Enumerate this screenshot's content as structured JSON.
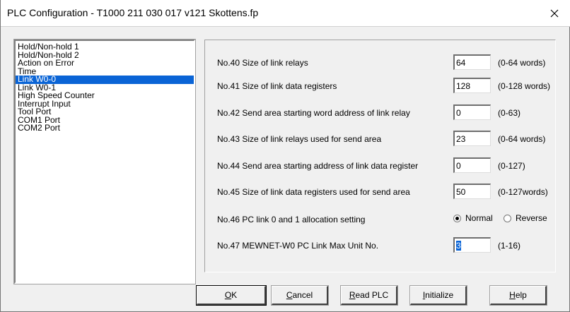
{
  "window": {
    "title": "PLC Configuration - T1000 211 030 017 v121 Skottens.fp",
    "close_glyph": "✕"
  },
  "sidebar": {
    "items": [
      {
        "label": "Hold/Non-hold 1",
        "selected": false
      },
      {
        "label": "Hold/Non-hold 2",
        "selected": false
      },
      {
        "label": "Action on Error",
        "selected": false
      },
      {
        "label": "Time",
        "selected": false
      },
      {
        "label": "Link W0-0",
        "selected": true
      },
      {
        "label": "Link W0-1",
        "selected": false
      },
      {
        "label": "High Speed Counter",
        "selected": false
      },
      {
        "label": "Interrupt Input",
        "selected": false
      },
      {
        "label": "Tool Port",
        "selected": false
      },
      {
        "label": "COM1 Port",
        "selected": false
      },
      {
        "label": "COM2 Port",
        "selected": false
      }
    ]
  },
  "settings": {
    "rows": [
      {
        "label": "No.40 Size of link relays",
        "value": "64",
        "range": "(0-64 words)"
      },
      {
        "label": "No.41 Size of link data registers",
        "value": "128",
        "range": "(0-128 words)"
      },
      {
        "label": "No.42 Send area starting word address of link relay",
        "value": "0",
        "range": "(0-63)"
      },
      {
        "label": "No.43 Size of link relays used for send area",
        "value": "23",
        "range": "(0-64 words)"
      },
      {
        "label": "No.44 Send area starting address of link data register",
        "value": "0",
        "range": "(0-127)"
      },
      {
        "label": "No.45 Size of link data registers used for send area",
        "value": "50",
        "range": "(0-127words)"
      }
    ],
    "allocation": {
      "label": "No.46 PC link 0 and 1 allocation setting",
      "option_normal": "Normal",
      "option_reverse": "Reverse",
      "selected": "Normal"
    },
    "max_unit": {
      "label": "No.47 MEWNET-W0 PC Link Max Unit No.",
      "value": "3",
      "range": "(1-16)"
    }
  },
  "buttons": {
    "ok": {
      "mnemonic": "O",
      "rest": "K"
    },
    "cancel": {
      "mnemonic": "C",
      "rest": "ancel"
    },
    "read_plc": {
      "mnemonic": "R",
      "rest": "ead PLC"
    },
    "initialize": {
      "mnemonic": "I",
      "rest": "nitialize"
    },
    "help": {
      "mnemonic": "H",
      "rest": "elp"
    }
  }
}
